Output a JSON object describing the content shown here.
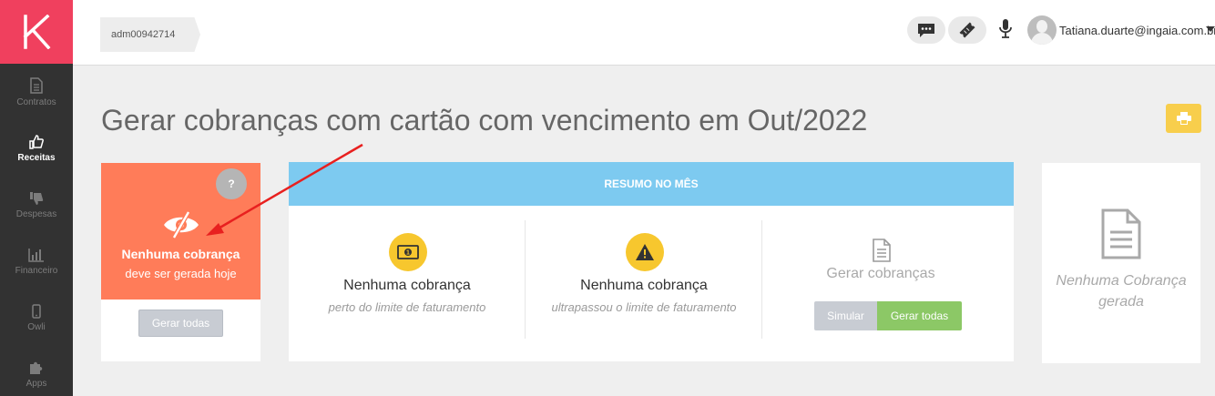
{
  "sidebar": {
    "items": [
      {
        "label": "Contratos",
        "icon": "document-icon"
      },
      {
        "label": "Receitas",
        "icon": "thumbs-up-icon"
      },
      {
        "label": "Despesas",
        "icon": "thumbs-down-icon"
      },
      {
        "label": "Financeiro",
        "icon": "bar-chart-icon"
      },
      {
        "label": "Owli",
        "icon": "mobile-icon"
      },
      {
        "label": "Apps",
        "icon": "puzzle-icon"
      }
    ],
    "active": "Receitas"
  },
  "header": {
    "breadcrumb": "adm00942714",
    "user_email": "Tatiana.duarte@ingaia.com.br"
  },
  "page_title": "Gerar cobranças com cartão com vencimento em Out/2022",
  "left_card": {
    "help": "?",
    "line1": "Nenhuma cobrança",
    "line2": "deve ser gerada hoje",
    "button": "Gerar todas"
  },
  "summary": {
    "header": "RESUMO NO MÊS",
    "col1": {
      "title": "Nenhuma cobrança",
      "subtitle": "perto do limite de faturamento"
    },
    "col2": {
      "title": "Nenhuma cobrança",
      "subtitle": "ultrapassou o limite de faturamento"
    },
    "col3": {
      "title": "Gerar cobranças",
      "simulate": "Simular",
      "generate": "Gerar todas"
    }
  },
  "right_card": {
    "line1": "Nenhuma Cobrança",
    "line2": "gerada"
  },
  "colors": {
    "brand": "#f0405e",
    "orange": "#ff7c59",
    "summary_header": "#7dcaf0",
    "yellow": "#f7c72e",
    "green": "#8cc866"
  }
}
